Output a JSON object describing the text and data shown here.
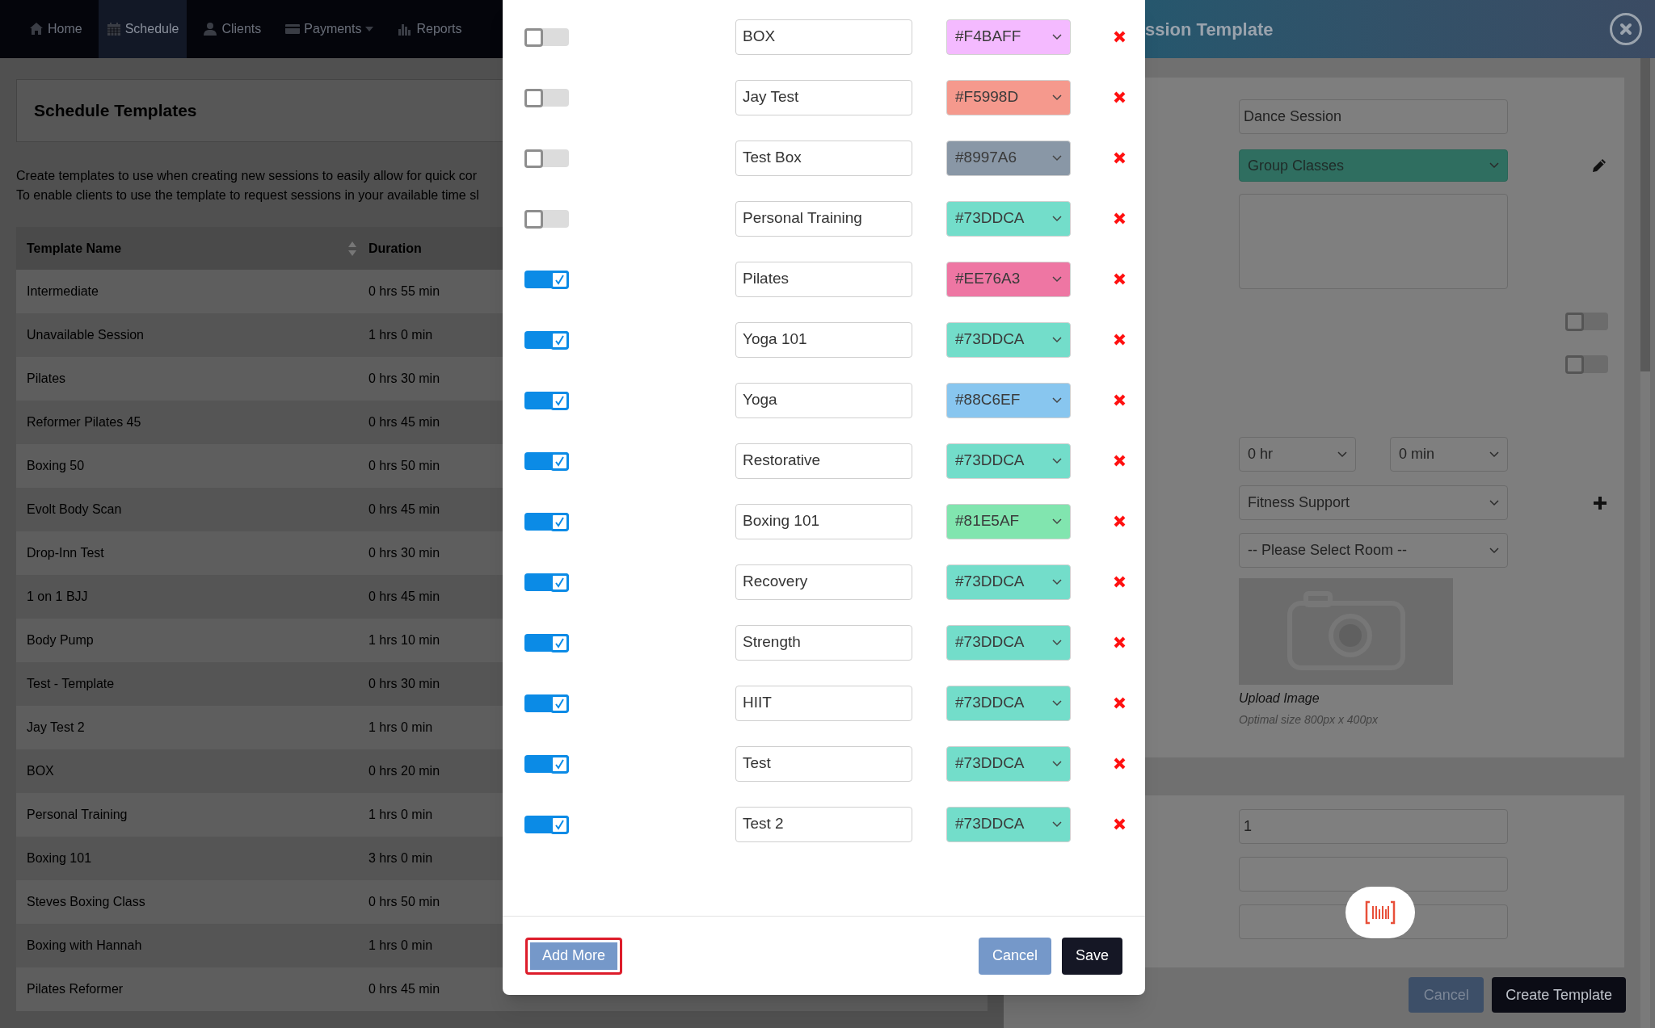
{
  "nav": [
    {
      "label": "Home",
      "selected": false
    },
    {
      "label": "Schedule",
      "selected": true
    },
    {
      "label": "Clients",
      "selected": false
    },
    {
      "label": "Payments",
      "selected": false
    },
    {
      "label": "Reports",
      "selected": false
    }
  ],
  "page": {
    "title": "Schedule Templates",
    "description": [
      "Create templates to use when creating new sessions to easily allow for quick cor",
      "To enable clients to use the template to request sessions in your available time sl"
    ],
    "table": {
      "columns": [
        "Template Name",
        "Duration"
      ],
      "rows": [
        [
          "Intermediate",
          "0 hrs 55 min"
        ],
        [
          "Unavailable Session",
          "1 hrs 0 min"
        ],
        [
          "Pilates",
          "0 hrs 30 min"
        ],
        [
          "Reformer Pilates 45",
          "0 hrs 45 min"
        ],
        [
          "Boxing 50",
          "0 hrs 50 min"
        ],
        [
          "Evolt Body Scan",
          "0 hrs 45 min"
        ],
        [
          "Drop-Inn Test",
          "0 hrs 30 min"
        ],
        [
          "1 on 1 BJJ",
          "0 hrs 45 min"
        ],
        [
          "Body Pump",
          "1 hrs 10 min"
        ],
        [
          "Test - Template",
          "0 hrs 30 min"
        ],
        [
          "Jay Test 2",
          "1 hrs 0 min"
        ],
        [
          "BOX",
          "0 hrs 20 min"
        ],
        [
          "Personal Training",
          "1 hrs 0 min"
        ],
        [
          "Boxing 101",
          "3 hrs 0 min"
        ],
        [
          "Steves Boxing Class",
          "0 hrs 50 min"
        ],
        [
          "Boxing with Hannah",
          "1 hrs 0 min"
        ],
        [
          "Pilates Reformer",
          "0 hrs 45 min"
        ]
      ]
    }
  },
  "template_panel": {
    "title": "ssion Template",
    "name": "Dance Session",
    "category": "Group Classes",
    "toggles": [
      {
        "on": false
      },
      {
        "on": false
      }
    ],
    "hours": "0 hr",
    "minutes": "0 min",
    "type": "Fitness Support",
    "room": "-- Please Select Room --",
    "upload_label": "Upload Image",
    "upload_hint": "Optimal size 800px x 400px",
    "capacity": "1",
    "buttons": [
      {
        "label": "Cancel",
        "kind": "secondary"
      },
      {
        "label": "Create Template",
        "kind": "primary"
      }
    ]
  },
  "modal": {
    "rows": [
      {
        "on": false,
        "name": "BOX",
        "color": "#f4baff",
        "color_label": "#F4BAFF"
      },
      {
        "on": false,
        "name": "Jay Test",
        "color": "#f5998d",
        "color_label": "#F5998D"
      },
      {
        "on": false,
        "name": "Test Box",
        "color": "#8997a6",
        "color_label": "#8997A6"
      },
      {
        "on": false,
        "name": "Personal Training",
        "color": "#73ddca",
        "color_label": "#73DDCA"
      },
      {
        "on": true,
        "name": "Pilates",
        "color": "#ee76a3",
        "color_label": "#EE76A3"
      },
      {
        "on": true,
        "name": "Yoga 101",
        "color": "#73ddca",
        "color_label": "#73DDCA"
      },
      {
        "on": true,
        "name": "Yoga",
        "color": "#88c6ef",
        "color_label": "#88C6EF"
      },
      {
        "on": true,
        "name": "Restorative",
        "color": "#73ddca",
        "color_label": "#73DDCA"
      },
      {
        "on": true,
        "name": "Boxing 101",
        "color": "#81e5af",
        "color_label": "#81E5AF"
      },
      {
        "on": true,
        "name": "Recovery",
        "color": "#73ddca",
        "color_label": "#73DDCA"
      },
      {
        "on": true,
        "name": "Strength",
        "color": "#73ddca",
        "color_label": "#73DDCA"
      },
      {
        "on": true,
        "name": "HIIT",
        "color": "#73ddca",
        "color_label": "#73DDCA"
      },
      {
        "on": true,
        "name": "Test",
        "color": "#73ddca",
        "color_label": "#73DDCA"
      },
      {
        "on": true,
        "name": "Test 2",
        "color": "#73ddca",
        "color_label": "#73DDCA"
      }
    ],
    "buttons": [
      {
        "label": "Add More",
        "kind": "add",
        "focused": true
      },
      {
        "label": "Cancel",
        "kind": "secondary",
        "focused": false
      },
      {
        "label": "Save",
        "kind": "primary",
        "focused": false
      }
    ]
  }
}
